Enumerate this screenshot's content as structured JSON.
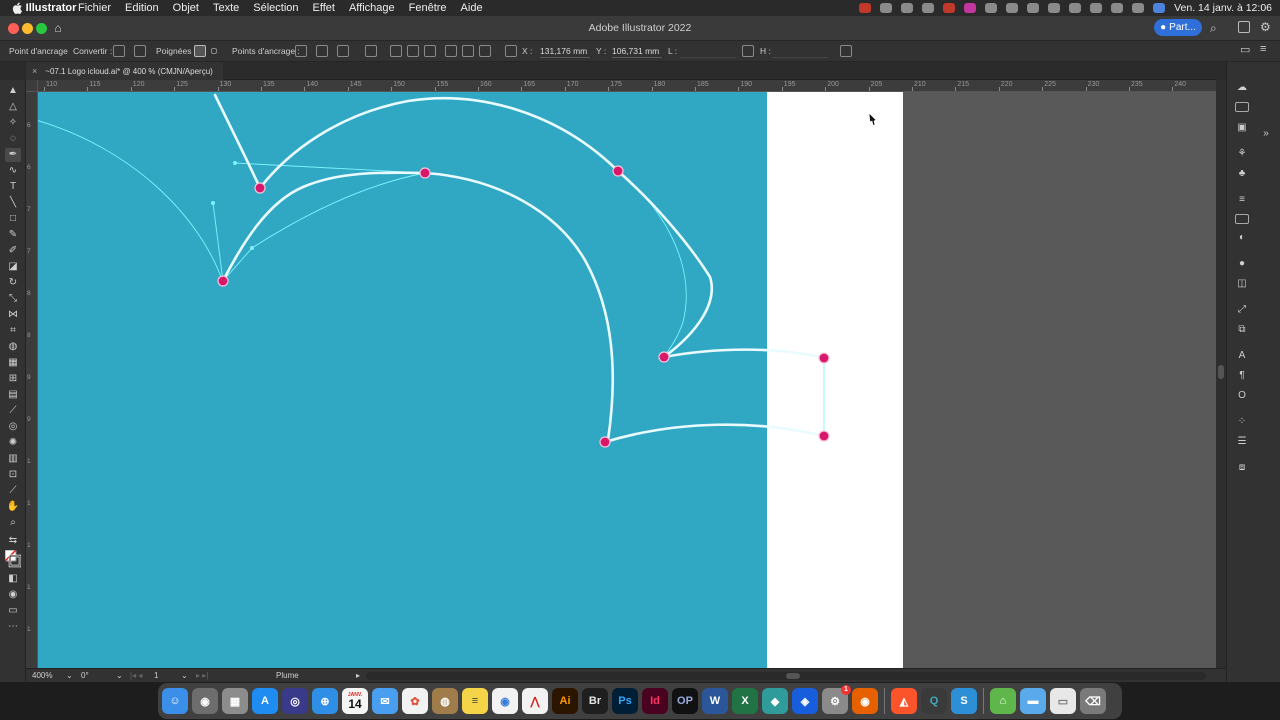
{
  "menubar": {
    "app_name": "Illustrator",
    "menus": [
      "Fichier",
      "Edition",
      "Objet",
      "Texte",
      "Sélection",
      "Effet",
      "Affichage",
      "Fenêtre",
      "Aide"
    ],
    "clock": "Ven. 14 janv. à 12:06"
  },
  "titlebar": {
    "title": "Adobe Illustrator 2022",
    "share_label": "Part..."
  },
  "controlbar": {
    "anchor_point_label": "Point d'ancrage",
    "convert_label": "Convertir :",
    "handles_label": "Poignées :",
    "anchor_points_label": "Points d'ancrage :",
    "x_label": "X :",
    "x_value": "131,176 mm",
    "y_label": "Y :",
    "y_value": "106,731 mm",
    "w_label": "L :",
    "h_label": "H :"
  },
  "document": {
    "tab_title": "~07.1 Logo icloud.ai* @ 400 % (CMJN/Aperçu)"
  },
  "ruler": {
    "top_labels": [
      "110",
      "115",
      "120",
      "125",
      "130",
      "135",
      "140",
      "145",
      "150",
      "155",
      "160",
      "165",
      "170",
      "175",
      "180",
      "185",
      "190",
      "195",
      "200",
      "205",
      "210",
      "215",
      "220",
      "225",
      "230",
      "235",
      "240",
      "245"
    ],
    "left_labels": [
      "6",
      "6",
      "7",
      "7",
      "8",
      "8",
      "9",
      "9",
      "1",
      "1",
      "1",
      "1",
      "1",
      "1"
    ]
  },
  "statusbar": {
    "zoom": "400%",
    "rotation": "0°",
    "artboard": "1",
    "tool": "Plume"
  },
  "colors": {
    "canvas_cyan": "#30a8c4",
    "path_stroke": "#e9fbff",
    "handle_line": "#7ef3ff",
    "anchor": "#d8196b",
    "artboard": "#ffffff",
    "pasteboard": "#595959"
  },
  "dock": {
    "apps": [
      "Finder",
      "Capture",
      "Launchpad",
      "App Store",
      "Siri",
      "Safari",
      "Calendrier",
      "Mail",
      "Photos",
      "Contacts",
      "Notes",
      "Chrome",
      "Acrobat",
      "Illustrator",
      "Bridge",
      "Photoshop",
      "InDesign",
      "DxO PhotoLab",
      "Word",
      "Excel",
      "Chromium",
      "Bitwarden",
      "Préférences Système",
      "Firefox",
      "Brave",
      "QuickTime",
      "Scrivener",
      "Affinity",
      "Dossier",
      "Aperçu",
      "Corbeille"
    ],
    "calendar_month": "JANV.",
    "calendar_day": "14",
    "badge": "1"
  }
}
